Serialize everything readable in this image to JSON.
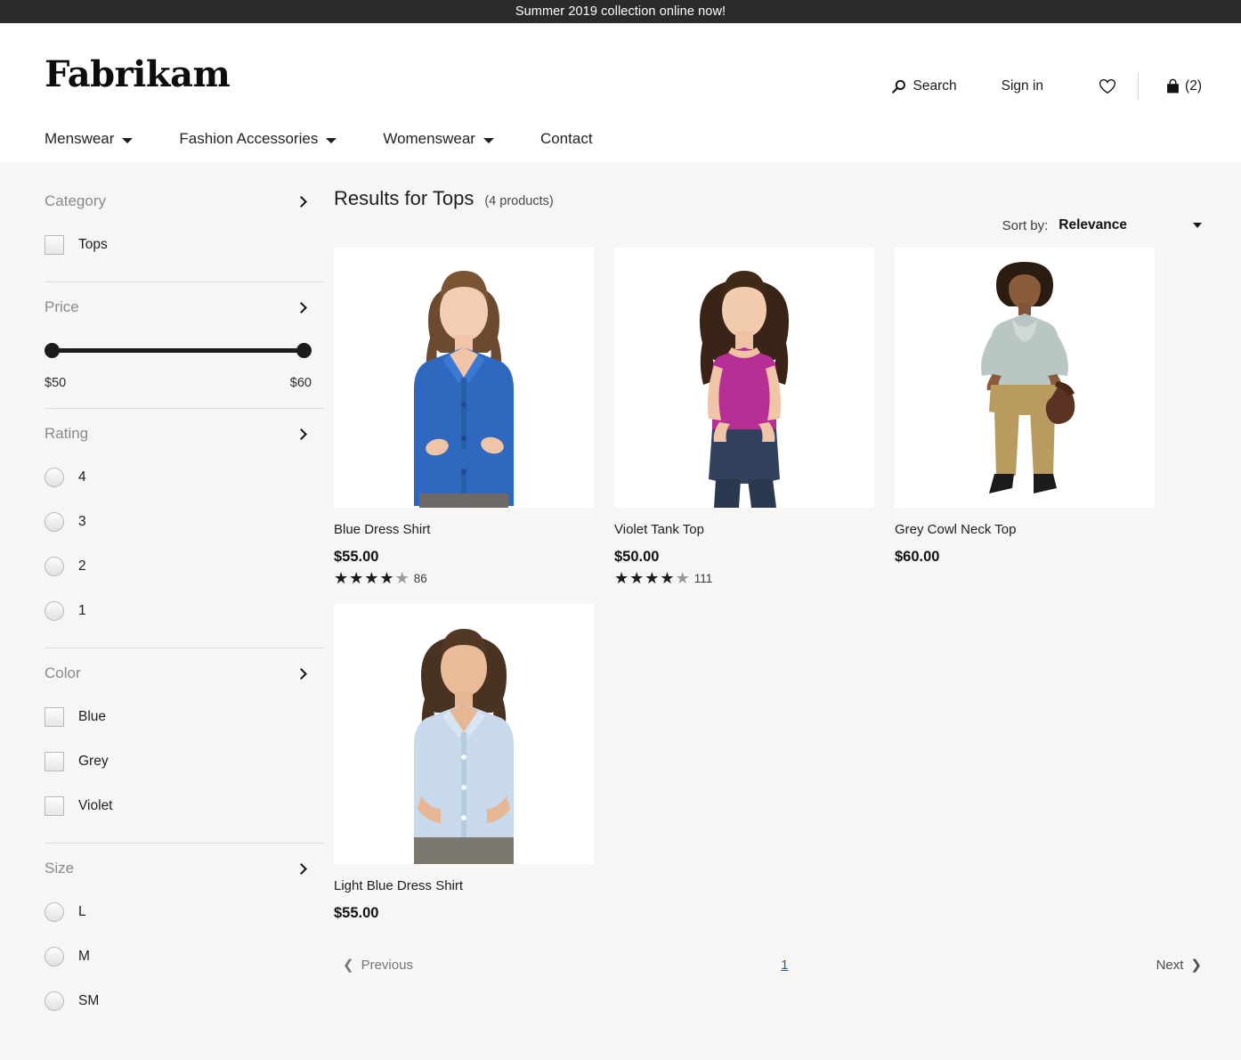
{
  "promo": {
    "text": "Summer 2019 collection online now!"
  },
  "header": {
    "brand": "Fabrikam",
    "search_label": "Search",
    "signin_label": "Sign in",
    "wishlist_icon": "heart-icon",
    "cart_count": "(2)"
  },
  "nav": {
    "items": [
      {
        "label": "Menswear",
        "has_caret": true
      },
      {
        "label": "Fashion Accessories",
        "has_caret": true
      },
      {
        "label": "Womenswear",
        "has_caret": true
      },
      {
        "label": "Contact",
        "has_caret": false
      }
    ]
  },
  "sidebar": {
    "groups": [
      {
        "title": "Category",
        "control": "checkbox",
        "options": [
          {
            "label": "Tops",
            "checked": false
          }
        ]
      },
      {
        "title": "Price",
        "control": "slider",
        "min_label": "$50",
        "max_label": "$60"
      },
      {
        "title": "Rating",
        "control": "radio",
        "options": [
          {
            "label": "4",
            "checked": false
          },
          {
            "label": "3",
            "checked": false
          },
          {
            "label": "2",
            "checked": false
          },
          {
            "label": "1",
            "checked": false
          }
        ]
      },
      {
        "title": "Color",
        "control": "checkbox",
        "options": [
          {
            "label": "Blue",
            "checked": false
          },
          {
            "label": "Grey",
            "checked": false
          },
          {
            "label": "Violet",
            "checked": false
          }
        ]
      },
      {
        "title": "Size",
        "control": "radio",
        "options": [
          {
            "label": "L",
            "checked": false
          },
          {
            "label": "M",
            "checked": false
          },
          {
            "label": "SM",
            "checked": false
          }
        ]
      }
    ]
  },
  "results": {
    "title": "Results for Tops",
    "count_text": "(4 products)",
    "sort_label": "Sort by:",
    "sort_value": "Relevance",
    "products": [
      {
        "name": "Blue Dress Shirt",
        "price": "$55.00",
        "stars_filled": 4,
        "stars_total": 5,
        "review_count": "86",
        "image": "woman-in-blue-button-shirt-arms-crossed"
      },
      {
        "name": "Violet Tank Top",
        "price": "$50.00",
        "stars_filled": 4,
        "stars_total": 5,
        "review_count": "111",
        "image": "woman-in-violet-tank-top-jeans"
      },
      {
        "name": "Grey Cowl Neck Top",
        "price": "$60.00",
        "stars_filled": 0,
        "stars_total": 0,
        "review_count": "",
        "image": "woman-in-grey-cowl-neck-top-tan-pants"
      },
      {
        "name": "Light Blue Dress Shirt",
        "price": "$55.00",
        "stars_filled": 0,
        "stars_total": 0,
        "review_count": "",
        "image": "woman-in-light-blue-dress-shirt"
      }
    ]
  },
  "pagination": {
    "previous_label": "Previous",
    "current_page": "1",
    "next_label": "Next"
  },
  "colors": {
    "banner_bg": "#2b2b2b",
    "page_bg": "#f7f6f4",
    "text_primary": "#1a1a1a",
    "filter_title": "#8a8a8a",
    "link": "#2f5d8a"
  }
}
